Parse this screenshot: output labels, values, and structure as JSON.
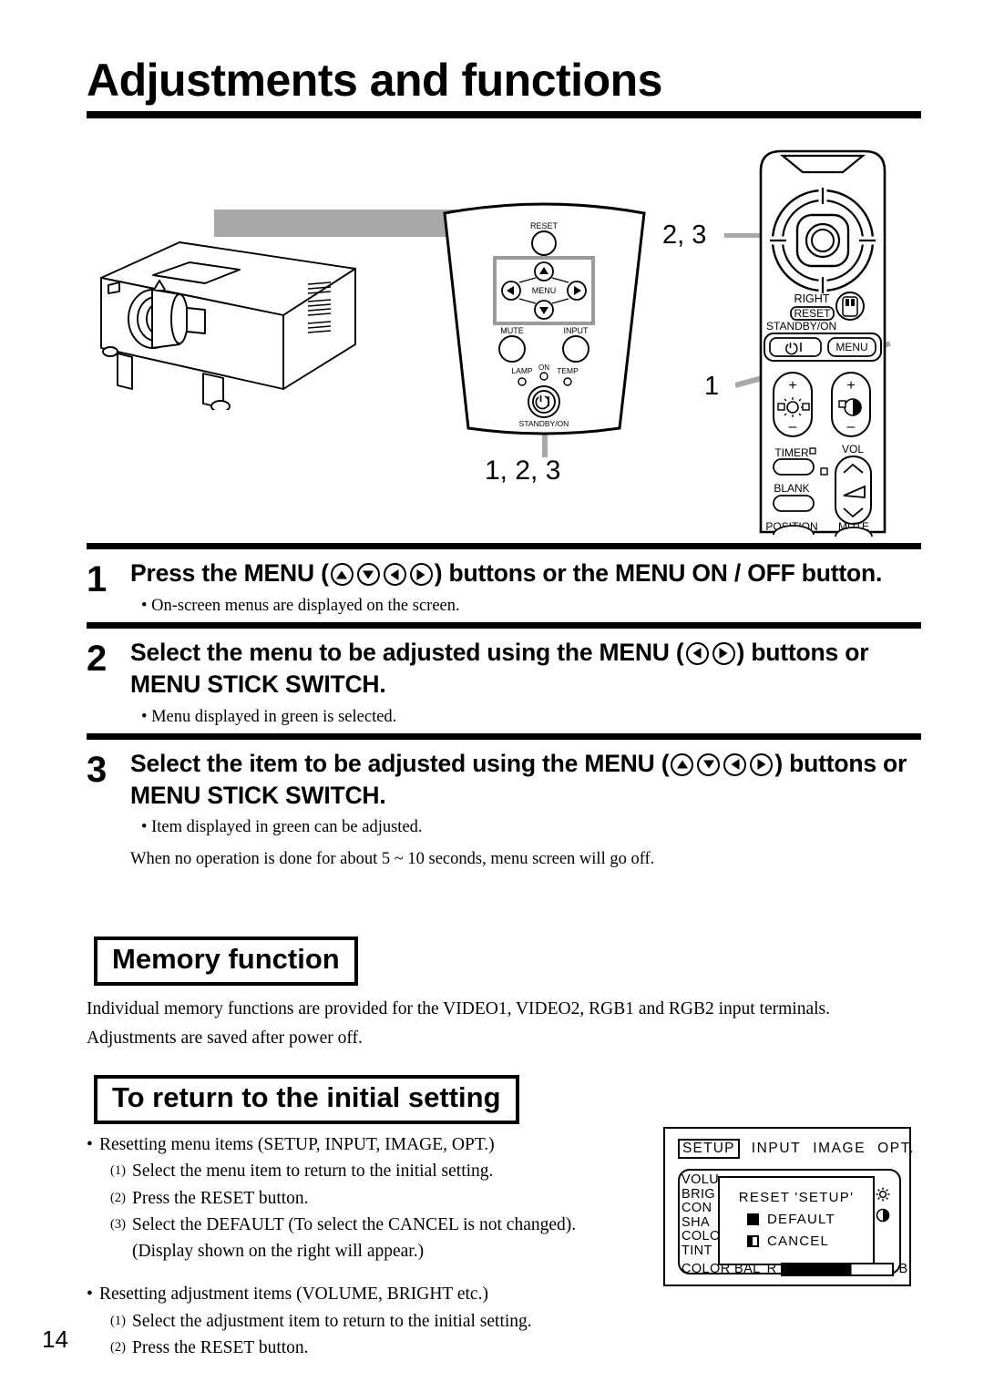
{
  "page": {
    "title": "Adjustments and functions",
    "number": "14"
  },
  "figure": {
    "callout_panel_top": "2, 3",
    "callout_remote": "1",
    "callout_panel_bottom": "1, 2, 3",
    "panel_labels": {
      "reset": "RESET",
      "menu": "MENU",
      "mute": "MUTE",
      "input": "INPUT",
      "lamp": "LAMP",
      "on": "ON",
      "temp": "TEMP",
      "standby_on": "STANDBY/ON"
    },
    "remote_labels": {
      "right": "RIGHT",
      "reset": "RESET",
      "standby_on": "STANDBY/ON",
      "menu": "MENU",
      "timer": "TIMER",
      "blank": "BLANK",
      "vol": "VOL",
      "position": "POSITION",
      "mute": "MUTE",
      "plus": "+",
      "minus": "–"
    }
  },
  "steps": [
    {
      "number": "1",
      "head_a": "Press the MENU (",
      "head_b": ") buttons or the MENU ON / OFF button.",
      "arrows": [
        "up",
        "down",
        "left",
        "right"
      ],
      "notes": [
        "• On-screen menus are displayed on the screen."
      ]
    },
    {
      "number": "2",
      "head_a": "Select the menu to be adjusted using the MENU (",
      "head_b": ") buttons or MENU STICK SWITCH.",
      "arrows": [
        "left",
        "right"
      ],
      "notes": [
        "• Menu displayed  in green is selected."
      ]
    },
    {
      "number": "3",
      "head_a": "Select the item to be adjusted using the MENU (",
      "head_b": ") buttons or MENU STICK SWITCH.",
      "arrows": [
        "up",
        "down",
        "left",
        "right"
      ],
      "notes": [
        "• Item displayed in green can be adjusted."
      ],
      "note_plain": "When no operation is done for about 5 ~ 10 seconds, menu screen will go off."
    }
  ],
  "memory": {
    "heading": "Memory function",
    "paragraph1": "Individual memory functions are provided for the VIDEO1, VIDEO2, RGB1 and RGB2 input terminals.",
    "paragraph2": "Adjustments are saved after power off."
  },
  "initial_setting": {
    "heading": "To return to the initial setting",
    "group1": {
      "bullet": "Resetting menu items (SETUP, INPUT, IMAGE, OPT.)",
      "items": [
        {
          "n": "(1)",
          "text": "Select the menu item to return to the initial setting."
        },
        {
          "n": "(2)",
          "text": "Press the RESET  button."
        },
        {
          "n": "(3)",
          "text": "Select the DEFAULT (To select the CANCEL is not changed)."
        }
      ],
      "continuation": "(Display shown on the right will appear.)"
    },
    "group2": {
      "bullet": "Resetting adjustment items (VOLUME, BRIGHT etc.)",
      "items": [
        {
          "n": "(1)",
          "text": "Select the adjustment item to return to the initial setting."
        },
        {
          "n": "(2)",
          "text": "Press the RESET button."
        }
      ]
    }
  },
  "osd": {
    "tabs": [
      "SETUP",
      "INPUT",
      "IMAGE",
      "OPT."
    ],
    "selected_tab": "SETUP",
    "menu_items": [
      "VOLU",
      "BRIG",
      "CON",
      "SHA",
      "COLO",
      "TINT"
    ],
    "color_bal_label": "COLOR BAL",
    "color_bal_left": "R",
    "color_bal_right": "B",
    "dialog": {
      "title": "RESET  'SETUP'",
      "option_default": "DEFAULT",
      "option_cancel": "CANCEL"
    }
  }
}
